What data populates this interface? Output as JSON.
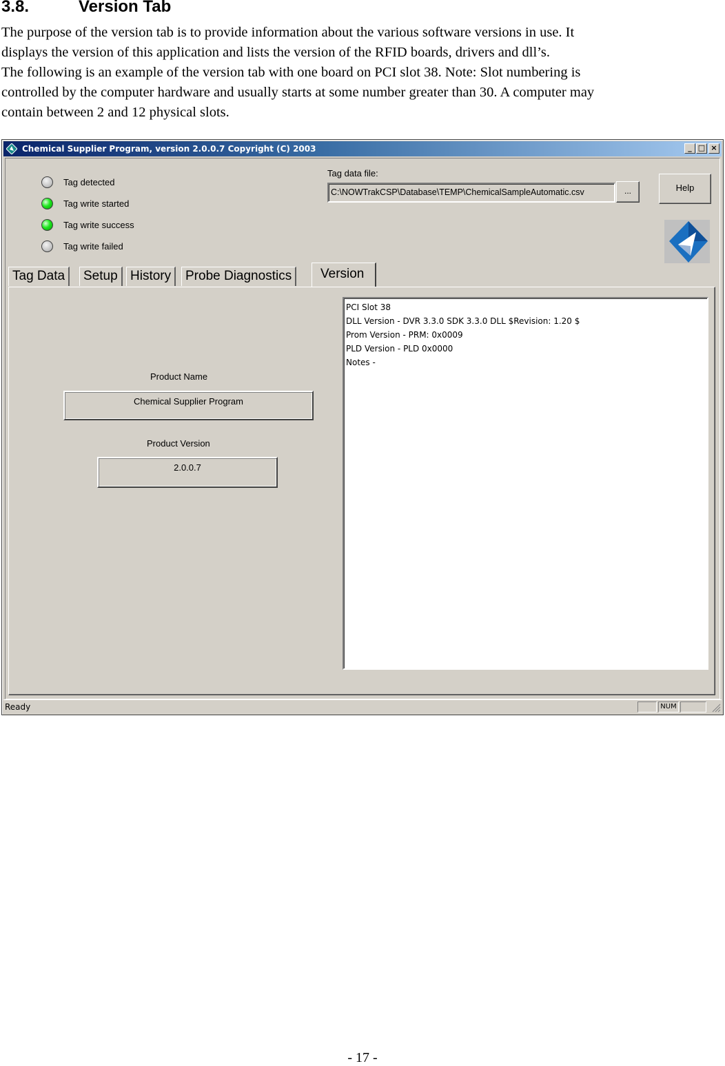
{
  "document": {
    "section_number": "3.8.",
    "section_title": "Version Tab",
    "paragraph1_lines": [
      "The purpose of the version tab is to provide information about the various software versions in use. It",
      "displays the version of this application and lists the version of the RFID boards, drivers and dll’s."
    ],
    "paragraph2_lines": [
      "The following is an example of the version tab with one board on PCI slot 38. Note: Slot numbering is",
      "controlled by the computer hardware and usually starts at some number greater than 30. A computer may",
      "contain between 2 and 12 physical slots."
    ],
    "page_number": "- 17 -"
  },
  "window": {
    "title": "Chemical Supplier Program, version 2.0.0.7 Copyright (C) 2003",
    "controls": {
      "minimize": "_",
      "maximize": "□",
      "close": "×"
    },
    "indicators": [
      {
        "label": "Tag detected",
        "state": "off"
      },
      {
        "label": "Tag write started",
        "state": "on"
      },
      {
        "label": "Tag write success",
        "state": "on"
      },
      {
        "label": "Tag write failed",
        "state": "off"
      }
    ],
    "tag_data_file": {
      "label": "Tag data file:",
      "value": "C:\\NOWTrakCSP\\Database\\TEMP\\ChemicalSampleAutomatic.csv",
      "browse_label": "...",
      "help_label": "Help"
    },
    "tabs": [
      {
        "label": "Tag Data",
        "active": false
      },
      {
        "label": "Setup",
        "active": false
      },
      {
        "label": "History",
        "active": false
      },
      {
        "label": "Probe Diagnostics",
        "active": false
      },
      {
        "label": "Version",
        "active": true
      }
    ],
    "version_tab": {
      "product_name_label": "Product Name",
      "product_name_value": "Chemical Supplier Program",
      "product_version_label": "Product Version",
      "product_version_value": "2.0.0.7",
      "info_lines": [
        "PCI Slot 38",
        "DLL Version - DVR 3.3.0 SDK 3.3.0 DLL $Revision: 1.20 $",
        "Prom Version - PRM: 0x0009",
        "PLD Version - PLD 0x0000",
        "Notes -"
      ]
    },
    "statusbar": {
      "text": "Ready",
      "panes": [
        "",
        "NUM",
        ""
      ]
    },
    "colors": {
      "titlebar_start": "#0a246a",
      "titlebar_end": "#a6caf0",
      "face": "#d4d0c8",
      "led_on": "#1ee81e",
      "logo_blue": "#1a6fc0"
    }
  }
}
